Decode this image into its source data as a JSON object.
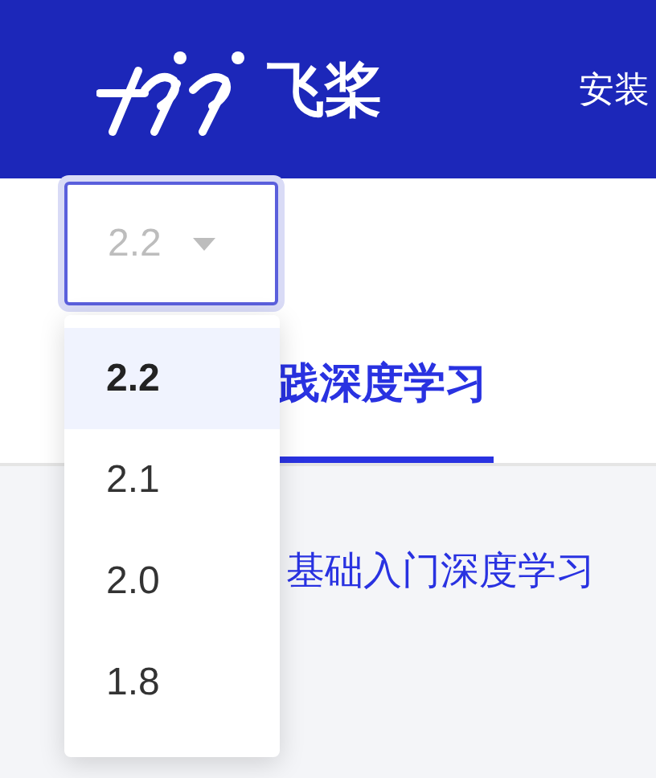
{
  "header": {
    "logo_text": "飞桨",
    "nav": [
      {
        "label": "安装"
      }
    ]
  },
  "version_select": {
    "value": "2.2",
    "expanded": true
  },
  "version_options": [
    {
      "label": "2.2",
      "selected": true
    },
    {
      "label": "2.1",
      "selected": false
    },
    {
      "label": "2.0",
      "selected": false
    },
    {
      "label": "1.8",
      "selected": false
    }
  ],
  "tabs": [
    {
      "label": "践深度学习",
      "selected": true
    }
  ],
  "content": {
    "link": "基础入门深度学习"
  }
}
